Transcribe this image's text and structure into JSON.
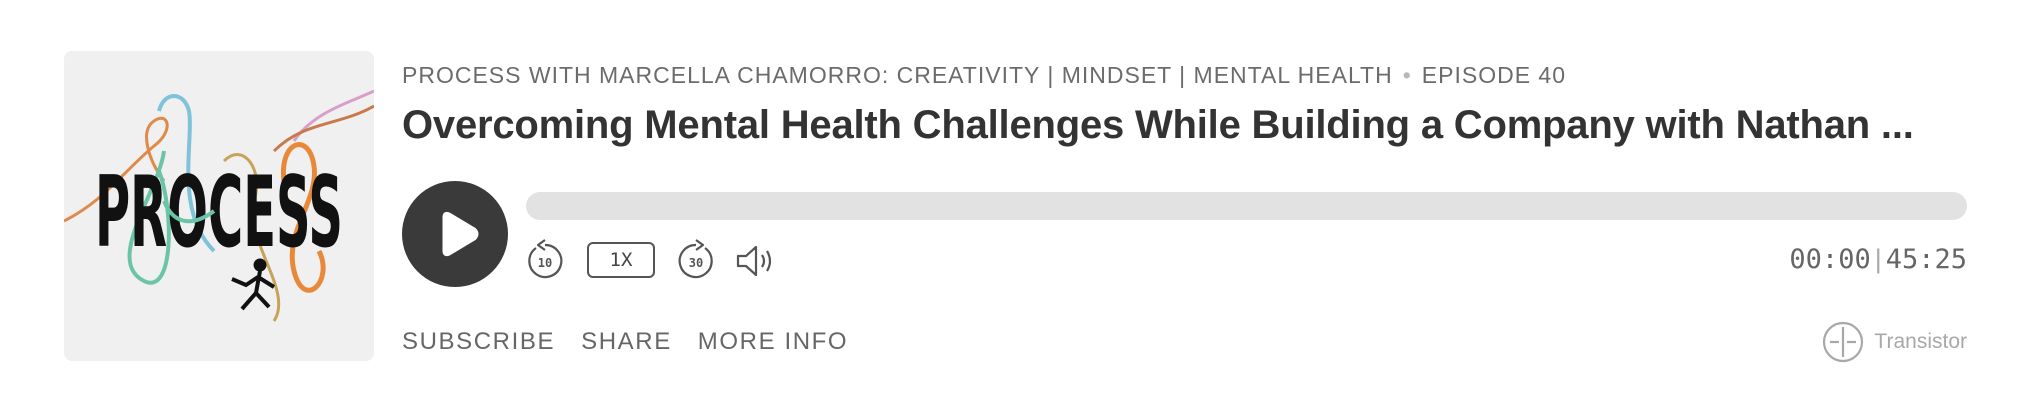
{
  "artwork": {
    "logo_text": "PROCESS",
    "icon": "podcast-cover-art"
  },
  "show": {
    "name": "PROCESS WITH MARCELLA CHAMORRO: CREATIVITY | MINDSET | MENTAL HEALTH",
    "separator": "•",
    "episode": "EPISODE 40"
  },
  "episode_title": "Overcoming Mental Health Challenges While Building a Company with Nathan ...",
  "player": {
    "play_icon": "play-icon",
    "progress": 0,
    "rewind_label": "10",
    "rewind_icon": "rewind-10-icon",
    "speed_label": "1X",
    "forward_label": "30",
    "forward_icon": "forward-30-icon",
    "volume_icon": "volume-icon",
    "current_time": "00:00",
    "time_separator": "|",
    "duration": "45:25"
  },
  "links": {
    "subscribe": "SUBSCRIBE",
    "share": "SHARE",
    "more_info": "MORE INFO"
  },
  "brand": {
    "name": "Transistor",
    "icon": "transistor-logo-icon"
  },
  "colors": {
    "text_dark": "#333333",
    "text_muted": "#6b6b6b",
    "button_dark": "#3a3a3a",
    "track": "#e2e2e2",
    "brand_gray": "#a8a8a8"
  }
}
